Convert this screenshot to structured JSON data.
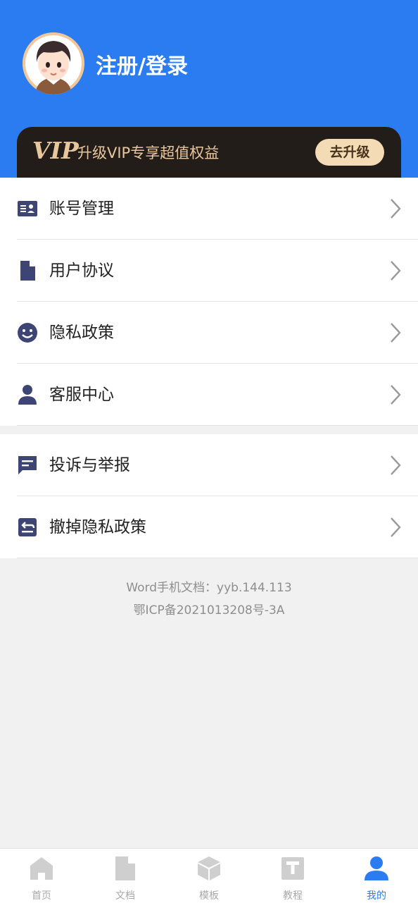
{
  "header": {
    "login_text": "注册/登录"
  },
  "vip": {
    "logo": "VIP",
    "text": "升级VIP专享超值权益",
    "button": "去升级"
  },
  "menu_group1": [
    {
      "label": "账号管理",
      "icon": "id-card-icon"
    },
    {
      "label": "用户协议",
      "icon": "document-icon"
    },
    {
      "label": "隐私政策",
      "icon": "smiley-icon"
    },
    {
      "label": "客服中心",
      "icon": "person-icon"
    }
  ],
  "menu_group2": [
    {
      "label": "投诉与举报",
      "icon": "chat-report-icon"
    },
    {
      "label": "撤掉隐私政策",
      "icon": "revoke-doc-icon"
    }
  ],
  "footer": {
    "version": "Word手机文档：yyb.144.113",
    "icp": "鄂ICP备2021013208号-3A"
  },
  "tabs": [
    {
      "label": "首页",
      "icon": "home-icon",
      "active": false
    },
    {
      "label": "文档",
      "icon": "file-icon",
      "active": false
    },
    {
      "label": "模板",
      "icon": "cube-icon",
      "active": false
    },
    {
      "label": "教程",
      "icon": "tutorial-icon",
      "active": false
    },
    {
      "label": "我的",
      "icon": "profile-icon",
      "active": true
    }
  ],
  "colors": {
    "primary": "#2b7cf0",
    "vip_gold": "#e8c79d",
    "vip_bg": "#231d1a",
    "icon": "#3d4574"
  }
}
